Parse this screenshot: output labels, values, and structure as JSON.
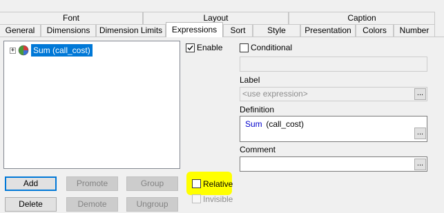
{
  "tabs_row1": [
    {
      "label": "Font"
    },
    {
      "label": "Layout"
    },
    {
      "label": "Caption"
    }
  ],
  "tabs_row2": [
    {
      "label": "General"
    },
    {
      "label": "Dimensions"
    },
    {
      "label": "Dimension Limits"
    },
    {
      "label": "Expressions"
    },
    {
      "label": "Sort"
    },
    {
      "label": "Style"
    },
    {
      "label": "Presentation"
    },
    {
      "label": "Colors"
    },
    {
      "label": "Number"
    }
  ],
  "active_tab": "Expressions",
  "tree": {
    "expander": "+",
    "items": [
      {
        "label": "Sum (call_cost)",
        "icon": "pie-chart-icon",
        "selected": true
      }
    ]
  },
  "buttons": {
    "add": "Add",
    "promote": "Promote",
    "group": "Group",
    "delete": "Delete",
    "demote": "Demote",
    "ungroup": "Ungroup"
  },
  "checkboxes": {
    "enable": {
      "label": "Enable",
      "checked": true
    },
    "conditional": {
      "label": "Conditional",
      "checked": false
    },
    "relative": {
      "label": "Relative",
      "checked": false
    },
    "invisible": {
      "label": "Invisible",
      "checked": false,
      "disabled": true
    }
  },
  "fields": {
    "label_caption": "Label",
    "label_placeholder": "<use expression>",
    "definition_caption": "Definition",
    "definition_value_func": "Sum",
    "definition_value_arg": " (call_cost)",
    "comment_caption": "Comment",
    "ellipsis": "..."
  },
  "colors": {
    "selection": "#0078d7",
    "highlight": "#ffff00",
    "function_blue": "#0000cc"
  }
}
